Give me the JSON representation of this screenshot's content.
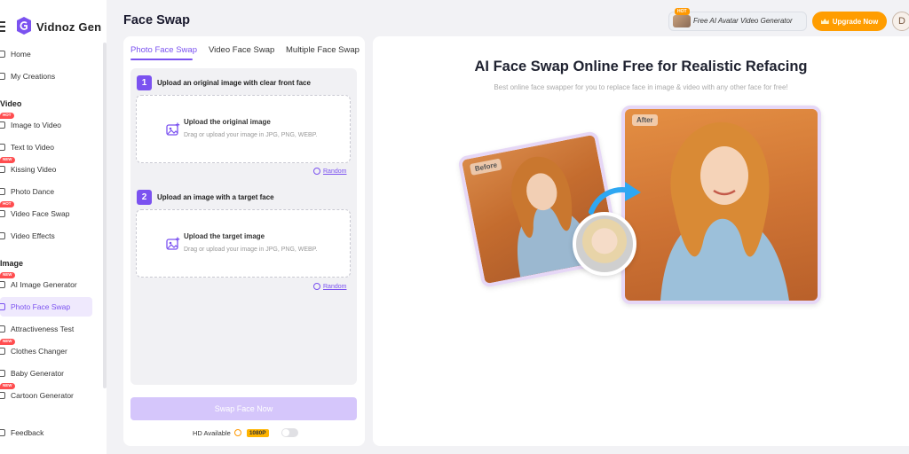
{
  "header": {
    "title": "Face Swap",
    "promo": {
      "badge": "HOT",
      "label": "Free AI Avatar Video Generator"
    },
    "upgrade_label": "Upgrade Now",
    "avatar_initial": "D"
  },
  "brand": {
    "name": "Vidnoz Gen"
  },
  "sidebar": {
    "home": "Home",
    "my_creations": "My Creations",
    "video_section": "Video",
    "video_items": [
      {
        "label": "Image to Video",
        "badge": "HOT"
      },
      {
        "label": "Text to Video",
        "badge": ""
      },
      {
        "label": "Kissing Video",
        "badge": "NEW"
      },
      {
        "label": "Photo Dance",
        "badge": ""
      },
      {
        "label": "Video Face Swap",
        "badge": "HOT"
      },
      {
        "label": "Video Effects",
        "badge": ""
      }
    ],
    "image_section": "Image",
    "image_items": [
      {
        "label": "AI Image Generator",
        "badge": "NEW"
      },
      {
        "label": "Photo Face Swap",
        "badge": ""
      },
      {
        "label": "Attractiveness Test",
        "badge": ""
      },
      {
        "label": "Clothes Changer",
        "badge": "NEW"
      },
      {
        "label": "Baby Generator",
        "badge": ""
      },
      {
        "label": "Cartoon Generator",
        "badge": "NEW"
      }
    ],
    "feedback": "Feedback"
  },
  "tabs": [
    "Photo Face Swap",
    "Video Face Swap",
    "Multiple Face Swap"
  ],
  "steps": [
    {
      "num": "1",
      "title": "Upload an original image with clear front face",
      "drop_title": "Upload the original image",
      "drop_sub": "Drag or upload your image in JPG, PNG, WEBP.",
      "random": "Random"
    },
    {
      "num": "2",
      "title": "Upload an image with a target face",
      "drop_title": "Upload the target image",
      "drop_sub": "Drag or upload your image in JPG, PNG, WEBP.",
      "random": "Random"
    }
  ],
  "swap_button": "Swap Face Now",
  "hd": {
    "label": "HD Available",
    "badge": "1080P"
  },
  "hero": {
    "title": "AI Face Swap Online Free for Realistic Refacing",
    "subtitle": "Best online face swapper for you to replace face in image & video with any other face for free!",
    "before_tag": "Before",
    "after_tag": "After"
  },
  "colors": {
    "accent": "#7b52f0",
    "upgrade": "#ff9d00",
    "hot_badge": "#ff4d4f"
  }
}
